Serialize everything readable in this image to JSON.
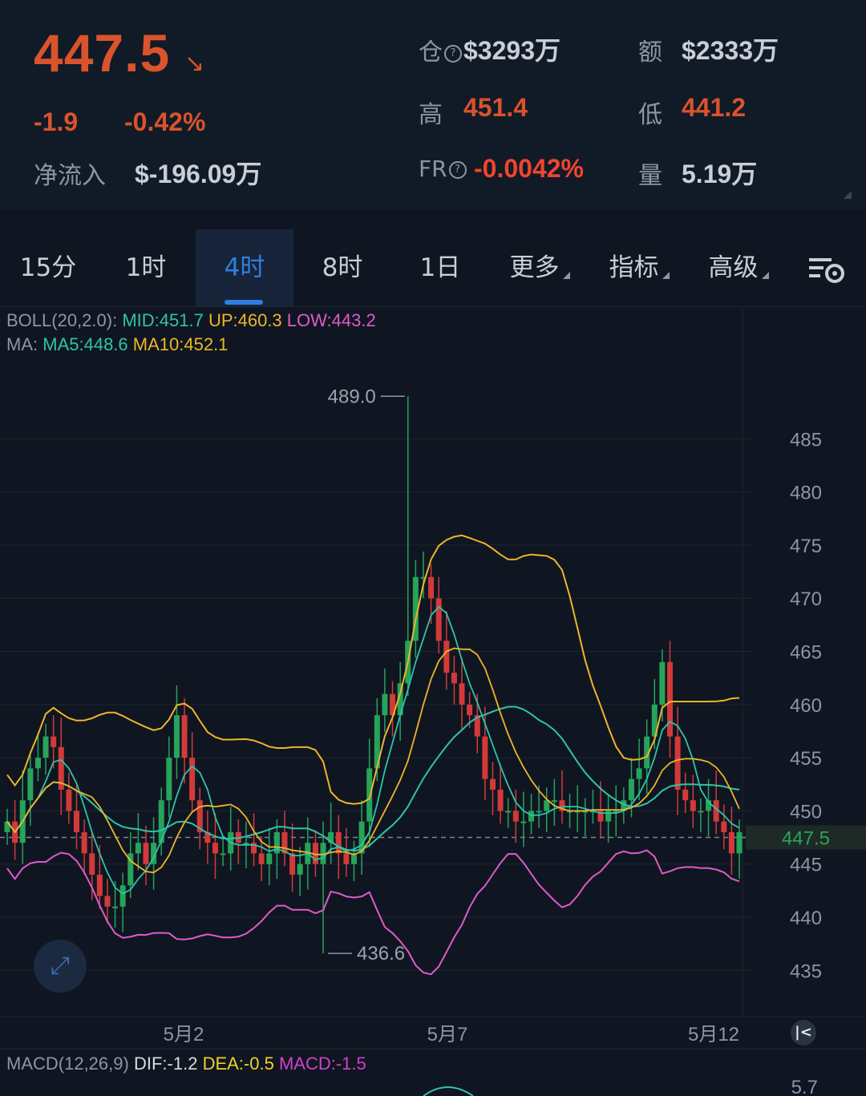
{
  "header": {
    "price": "447.5",
    "change": "-1.9",
    "change_pct": "-0.42%",
    "netflow_label": "净流入",
    "netflow_value": "$-196.09万",
    "oi_label": "仓",
    "oi_value": "$3293万",
    "amount_label": "额",
    "amount_value": "$2333万",
    "high_label": "高",
    "high_value": "451.4",
    "low_label": "低",
    "low_value": "441.2",
    "fr_label": "FR",
    "fr_value": "-0.0042%",
    "volume_label": "量",
    "volume_value": "5.19万"
  },
  "tabs": [
    "15分",
    "1时",
    "4时",
    "8时",
    "1日",
    "更多",
    "指标",
    "高级"
  ],
  "indicators": {
    "boll_label": "BOLL(20,2.0):",
    "boll_mid": "MID:451.7",
    "boll_up": "UP:460.3",
    "boll_low": "LOW:443.2",
    "ma_label": "MA:",
    "ma5": "MA5:448.6",
    "ma10": "MA10:452.1",
    "macd_label": "MACD(12,26,9)",
    "dif": "DIF:-1.2",
    "dea": "DEA:-0.5",
    "macd": "MACD:-1.5"
  },
  "colors": {
    "up": "#27a35a",
    "down": "#d23a3a",
    "accent": "#2f7fe0",
    "mid": "#2ec4a8",
    "upper": "#f0b429",
    "lower": "#e05ac8"
  },
  "chart_data": {
    "type": "candlestick",
    "y_ticks": [
      485,
      480,
      475,
      470,
      465,
      460,
      455,
      450,
      445,
      440,
      435
    ],
    "x_ticks": [
      "5月2",
      "5月7",
      "5月12"
    ],
    "last_price": "447.5",
    "max_label": "489.0",
    "min_label": "436.6",
    "macd_axis_label": "5.7",
    "ylim": [
      431.5,
      490.5
    ]
  }
}
